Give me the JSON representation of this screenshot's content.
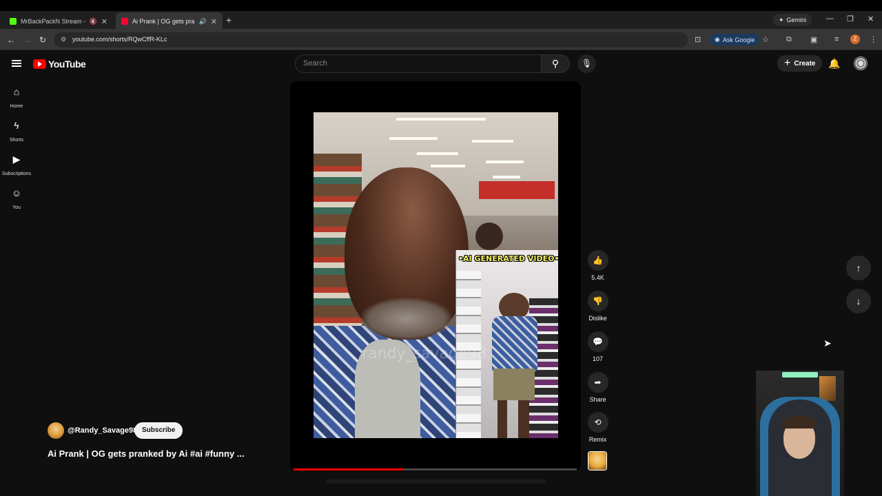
{
  "browser": {
    "tabs": [
      {
        "title": "MrBackPackN Stream - Wa",
        "favicon_color": "#53fc18"
      },
      {
        "title": "Ai Prank | OG gets pranked",
        "favicon_color": "#ff0033"
      }
    ],
    "gemini_label": "Gemini",
    "url": "youtube.com/shorts/RQwCffR-KLc",
    "ask_google_label": "Ask Google",
    "profile_initial": "Z"
  },
  "youtube": {
    "logo_text": "YouTube",
    "search_placeholder": "Search",
    "create_label": "Create",
    "sidebar": [
      {
        "label": "Home",
        "icon": "home-icon"
      },
      {
        "label": "Shorts",
        "icon": "shorts-icon"
      },
      {
        "label": "Subscriptions",
        "icon": "subscriptions-icon"
      },
      {
        "label": "You",
        "icon": "you-icon"
      }
    ]
  },
  "video": {
    "overlay_text": "•AI GENERATED VIDEO•",
    "watermark_text": "randy_savage98",
    "progress": 0.39,
    "channel": "@Randy_Savage98",
    "subscribe_label": "Subscribe",
    "title": "Ai Prank | OG gets pranked by Ai #ai #funny ..."
  },
  "actions": {
    "like_count": "5.4K",
    "dislike_label": "Dislike",
    "comment_count": "107",
    "share_label": "Share",
    "remix_label": "Remix"
  },
  "colors": {
    "accent_red": "#ff0000",
    "background": "#0f0f0f",
    "overlay_yellow": "#f4f26a"
  }
}
